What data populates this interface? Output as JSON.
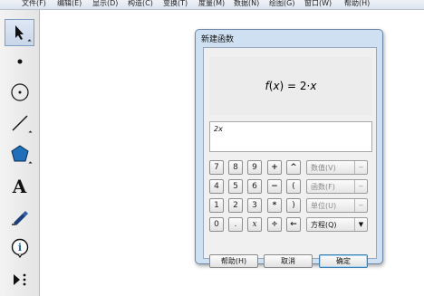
{
  "menu": [
    {
      "label": "文件(F)",
      "id": "file"
    },
    {
      "label": "编辑(E)",
      "id": "edit"
    },
    {
      "label": "显示(D)",
      "id": "display"
    },
    {
      "label": "构造(C)",
      "id": "construct"
    },
    {
      "label": "变换(T)",
      "id": "transform"
    },
    {
      "label": "度量(M)",
      "id": "measure"
    },
    {
      "label": "数据(N)",
      "id": "data"
    },
    {
      "label": "绘图(G)",
      "id": "graph"
    },
    {
      "label": "窗口(W)",
      "id": "window"
    },
    {
      "label": "帮助(H)",
      "id": "help"
    }
  ],
  "tools": [
    {
      "name": "arrow-select-icon",
      "active": true
    },
    {
      "name": "point-tool-icon"
    },
    {
      "name": "compass-tool-icon"
    },
    {
      "name": "straightedge-tool-icon"
    },
    {
      "name": "polygon-tool-icon"
    },
    {
      "name": "text-tool-icon",
      "glyph": "A"
    },
    {
      "name": "marker-tool-icon"
    },
    {
      "name": "information-tool-icon",
      "glyph": "i"
    },
    {
      "name": "custom-tool-icon"
    }
  ],
  "dialog": {
    "title": "新建函数",
    "preview_f": "f",
    "preview_x": "x",
    "preview_rest_a": ") = 2·",
    "preview_x2": "x",
    "preview_open": "(",
    "expression": "2x",
    "keys": {
      "k7": "7",
      "k8": "8",
      "k9": "9",
      "kplus": "+",
      "kpow": "^",
      "k4": "4",
      "k5": "5",
      "k6": "6",
      "kminus": "−",
      "klp": "(",
      "k1": "1",
      "k2": "2",
      "k3": "3",
      "kmul": "*",
      "krp": ")",
      "k0": "0",
      "kdot": ".",
      "kx": "x",
      "kdiv": "÷",
      "kback": "←"
    },
    "value_menu": "数值(V)",
    "function_menu": "函数(F)",
    "units_menu": "单位(U)",
    "equation_menu": "方程(Q)",
    "menu_arrow": "−",
    "equation_arrow": "▼",
    "help_button": "帮助(H)",
    "cancel_button": "取消",
    "ok_button": "确定"
  }
}
